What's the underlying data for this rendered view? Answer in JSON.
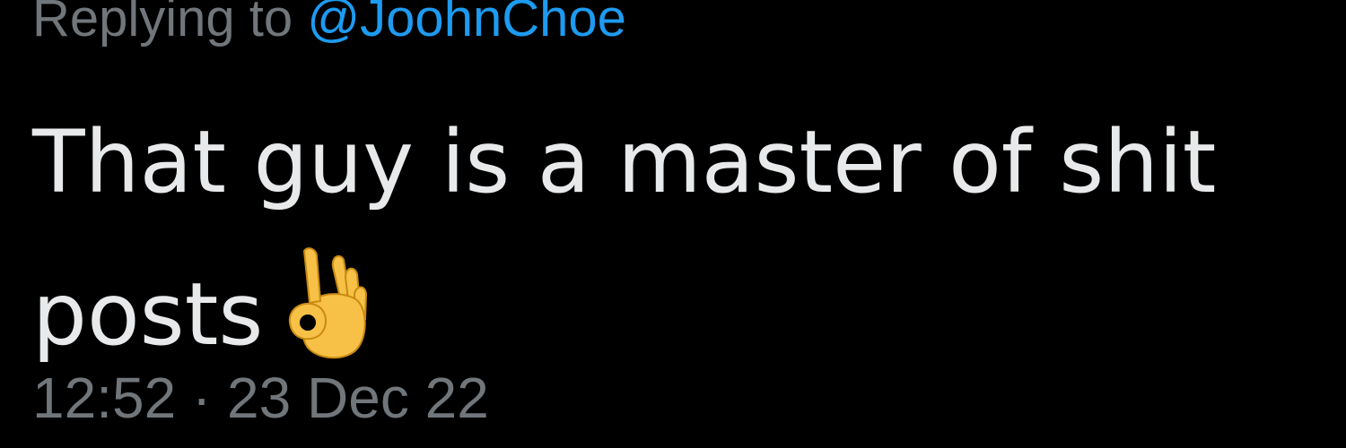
{
  "reply": {
    "prefix": "Replying to",
    "handle": "@JoohnChoe"
  },
  "tweet": {
    "text_line1": "That guy is a master of shit",
    "text_line2": "posts",
    "emoji_icon": "ok-hand-emoji-icon"
  },
  "meta": {
    "time": "12:52",
    "separator": "·",
    "date": "23 Dec 22"
  },
  "colors": {
    "background": "#000000",
    "text": "#e7e9ea",
    "muted": "#71767b",
    "link": "#1d9bf0",
    "emoji": "#f6c146"
  }
}
